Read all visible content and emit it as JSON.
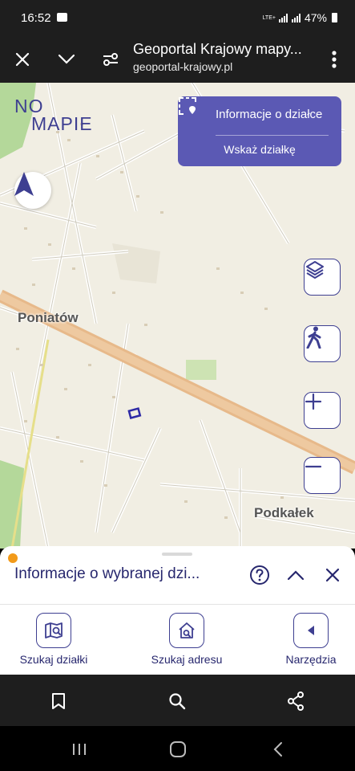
{
  "status": {
    "time": "16:52",
    "network": "LTE+",
    "battery": "47%"
  },
  "browser": {
    "title": "Geoportal Krajowy mapy...",
    "url": "geoportal-krajowy.pl",
    "close_icon": "close-icon",
    "menu_icon": "more-vert-icon"
  },
  "map": {
    "logo_line1": "NO",
    "logo_line2": "MAPIE",
    "places": [
      "Poniatów",
      "Podkałek"
    ],
    "panel": {
      "info_label": "Informacje o działce",
      "select_label": "Wskaż działkę"
    },
    "buttons": [
      "layers-icon",
      "pedestrian-icon",
      "zoom-in-icon",
      "zoom-out-icon"
    ],
    "accent": "#5b59b4",
    "brand": "#3e3f91"
  },
  "sheet": {
    "title": "Informacje o wybranej dzi...",
    "status_color": "#f29a19"
  },
  "toolbar": {
    "tools": [
      {
        "label": "Szukaj działki"
      },
      {
        "label": "Szukaj adresu"
      },
      {
        "label": "Narzędzia"
      }
    ]
  }
}
